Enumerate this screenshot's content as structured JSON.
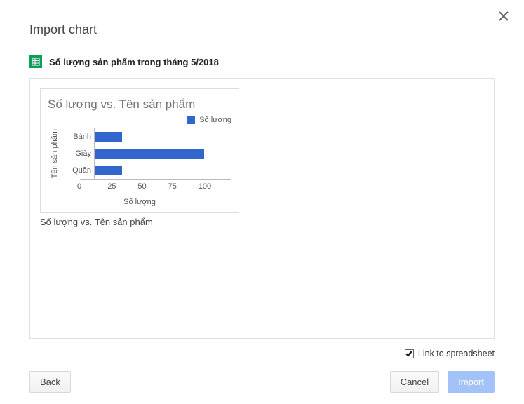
{
  "dialog": {
    "title": "Import chart",
    "spreadsheet_name": "Số lượng sản phẩm trong tháng 5/2018",
    "link_checkbox_label": "Link to spreadsheet",
    "link_checked": true,
    "back_label": "Back",
    "cancel_label": "Cancel",
    "import_label": "Import"
  },
  "chart_preview": {
    "caption": "Số lượng vs. Tên sản phẩm"
  },
  "chart_data": {
    "type": "bar",
    "orientation": "horizontal",
    "title": "Số lượng vs. Tên sản phẩm",
    "xlabel": "Số lượng",
    "ylabel": "Tên sản phẩm",
    "legend": [
      "Số lượng"
    ],
    "categories": [
      "Bánh",
      "Giày",
      "Quần"
    ],
    "values": [
      20,
      80,
      20
    ],
    "xlim": [
      0,
      100
    ],
    "xticks": [
      0,
      25,
      50,
      75,
      100
    ],
    "color": "#3366cc"
  }
}
